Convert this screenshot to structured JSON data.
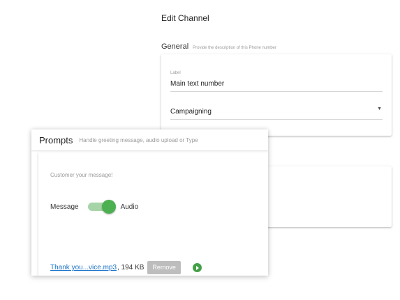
{
  "page": {
    "title": "Edit Channel"
  },
  "general": {
    "title": "General",
    "description": "Provide the description of this Phone number",
    "label_field": {
      "label": "Label",
      "value": "Main text number"
    },
    "type_select": {
      "value": "Campaigning",
      "arrow_icon": "caret-down-icon"
    }
  },
  "prompts": {
    "title": "Prompts",
    "description": "Handle greeting message, audio upload or Type",
    "customer_message": "Customer your message!",
    "toggle": {
      "left_label": "Message",
      "right_label": "Audio",
      "state": "Audio",
      "color": "#4caf50"
    },
    "file": {
      "name": "Thank you...vice.mp3",
      "size": ", 194 KB",
      "remove_label": "Remove",
      "play_icon": "play-icon",
      "play_color": "#43a047"
    }
  }
}
